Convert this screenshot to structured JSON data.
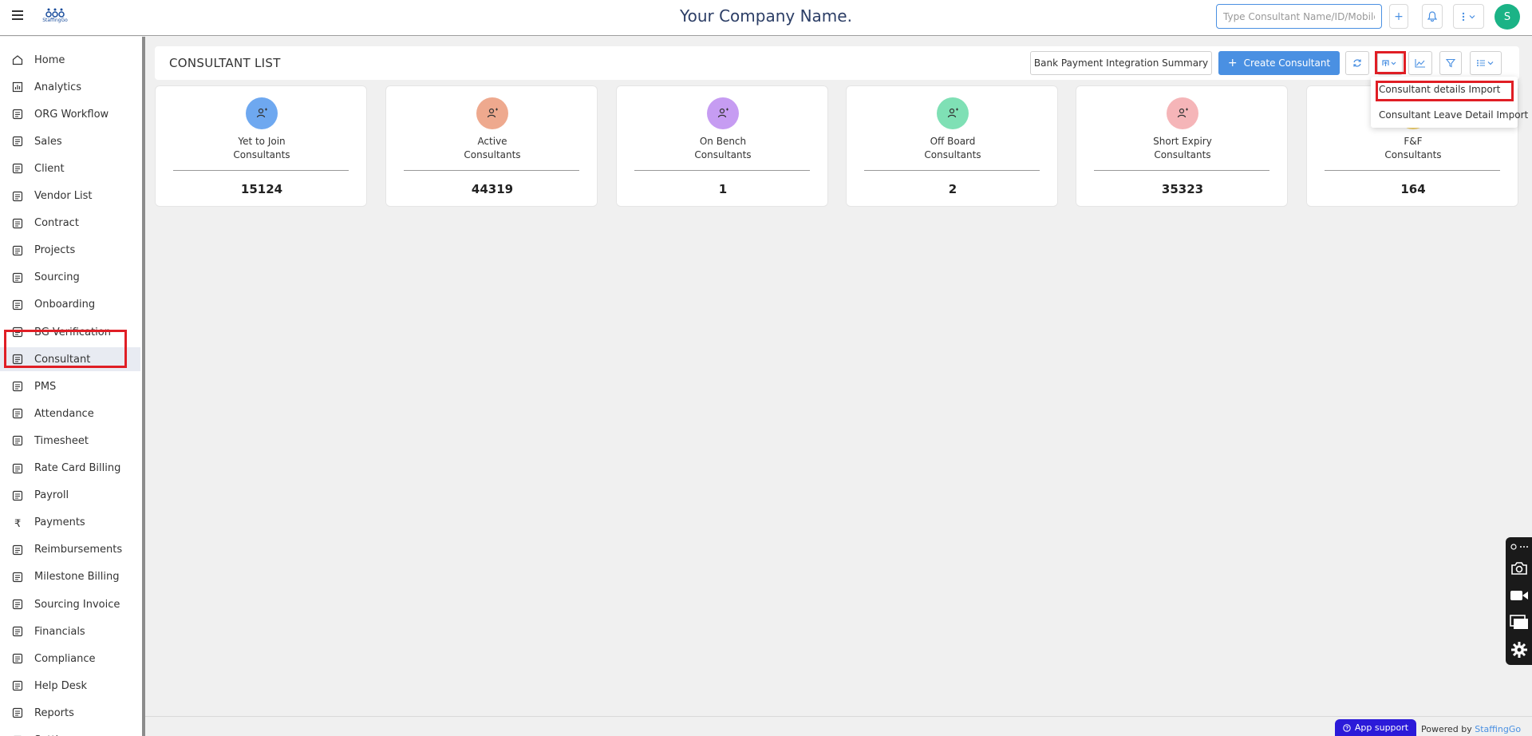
{
  "header": {
    "logo_text": "StaffingGo",
    "company_name": "Your Company Name.",
    "search_placeholder": "Type Consultant Name/ID/Mobile/...",
    "add_icon": "plus-icon",
    "bell_icon": "bell-icon",
    "more_icon": "more-vertical-icon",
    "avatar_initial": "S",
    "avatar_color": "#1bb386"
  },
  "sidebar": {
    "items": [
      {
        "label": "Home",
        "icon": "home-icon"
      },
      {
        "label": "Analytics",
        "icon": "analytics-icon"
      },
      {
        "label": "ORG Workflow",
        "icon": "workflow-icon"
      },
      {
        "label": "Sales",
        "icon": "sales-icon"
      },
      {
        "label": "Client",
        "icon": "client-icon"
      },
      {
        "label": "Vendor List",
        "icon": "vendor-list-icon"
      },
      {
        "label": "Contract",
        "icon": "contract-icon"
      },
      {
        "label": "Projects",
        "icon": "projects-icon"
      },
      {
        "label": "Sourcing",
        "icon": "sourcing-icon"
      },
      {
        "label": "Onboarding",
        "icon": "onboarding-icon"
      },
      {
        "label": "BG Verification",
        "icon": "bg-verification-icon"
      },
      {
        "label": "Consultant",
        "icon": "consultant-icon"
      },
      {
        "label": "PMS",
        "icon": "pms-icon"
      },
      {
        "label": "Attendance",
        "icon": "attendance-icon"
      },
      {
        "label": "Timesheet",
        "icon": "timesheet-icon"
      },
      {
        "label": "Rate Card Billing",
        "icon": "rate-card-icon"
      },
      {
        "label": "Payroll",
        "icon": "payroll-icon"
      },
      {
        "label": "Payments",
        "icon": "rupee-icon"
      },
      {
        "label": "Reimbursements",
        "icon": "reimbursements-icon"
      },
      {
        "label": "Milestone Billing",
        "icon": "milestone-icon"
      },
      {
        "label": "Sourcing Invoice",
        "icon": "invoice-icon"
      },
      {
        "label": "Financials",
        "icon": "financials-icon"
      },
      {
        "label": "Compliance",
        "icon": "compliance-icon"
      },
      {
        "label": "Help Desk",
        "icon": "help-icon"
      },
      {
        "label": "Reports",
        "icon": "reports-icon"
      },
      {
        "label": "Settings",
        "icon": "settings-icon"
      }
    ],
    "active": "Consultant"
  },
  "page": {
    "title": "CONSULTANT LIST",
    "bank_summary_label": "Bank Payment Integration Summary",
    "create_label": "Create Consultant",
    "primary_color": "#4a90e2"
  },
  "cards": [
    {
      "line1": "Yet to Join",
      "line2": "Consultants",
      "value": "15124",
      "color": "#6ea8f0"
    },
    {
      "line1": "Active",
      "line2": "Consultants",
      "value": "44319",
      "color": "#eea98e"
    },
    {
      "line1": "On Bench",
      "line2": "Consultants",
      "value": "1",
      "color": "#c69cf2"
    },
    {
      "line1": "Off Board",
      "line2": "Consultants",
      "value": "2",
      "color": "#7fe0b5"
    },
    {
      "line1": "Short Expiry",
      "line2": "Consultants",
      "value": "35323",
      "color": "#f5b5b8"
    },
    {
      "line1": "F&F",
      "line2": "Consultants",
      "value": "164",
      "color": "#f5d46e"
    }
  ],
  "import_menu": {
    "items": [
      "Consultant details Import",
      "Consultant Leave Detail Import"
    ]
  },
  "footer": {
    "app_support": "App support",
    "powered_by": "Powered by",
    "brand": "StaffingGo"
  }
}
